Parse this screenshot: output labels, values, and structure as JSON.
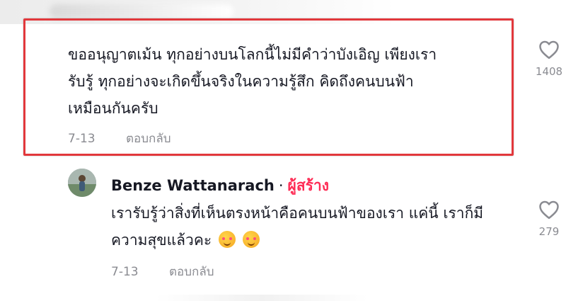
{
  "comment": {
    "text": "ขออนุญาตเม้น ทุกอย่างบนโลกนี้ไม่มีคำว่าบังเอิญ เพียงเรา\nรับรู้ ทุกอย่างจะเกิดขึ้นจริงในความรู้สึก คิดถึงคนบนฟ้า\nเหมือนกันครับ",
    "date": "7-13",
    "reply_label": "ตอบกลับ",
    "likes": "1408"
  },
  "reply": {
    "author": "Benze Wattanarach",
    "separator": "·",
    "creator_label": "ผู้สร้าง",
    "text": "เรารับรู้ว่าสิ่งที่เห็นตรงหน้าคือคนบนฟ้าของเรา แค่นี้ เราก็มีความสุขแล้วคะ",
    "emojis": [
      "smiling-face-with-hearts",
      "smiling-face-with-hearts"
    ],
    "date": "7-13",
    "reply_label": "ตอบกลับ",
    "likes": "279"
  },
  "colors": {
    "highlight": "#e2383c",
    "creator": "#fe2c55",
    "meta": "#8a8b91",
    "text": "#161823"
  }
}
